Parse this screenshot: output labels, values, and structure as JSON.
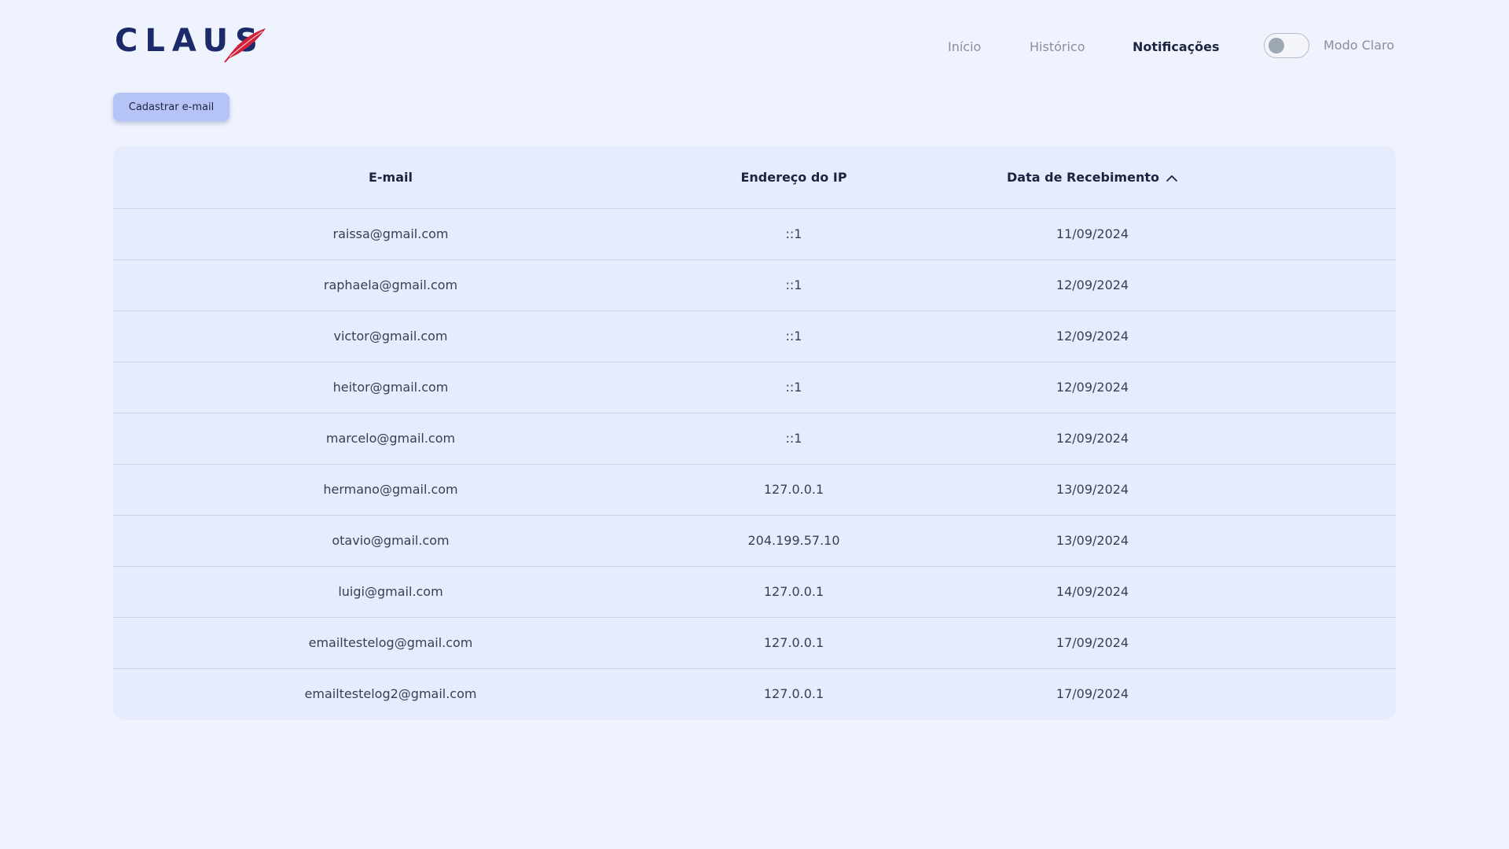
{
  "brand": {
    "logo_text": "CLAUS",
    "accent_color": "#d0213a",
    "primary_color": "#1a2a6a"
  },
  "nav": {
    "items": [
      {
        "label": "Início",
        "active": false
      },
      {
        "label": "Histórico",
        "active": false
      },
      {
        "label": "Notificações",
        "active": true
      }
    ]
  },
  "theme_toggle": {
    "label": "Modo Claro",
    "enabled": false
  },
  "actions": {
    "register_label": "Cadastrar e-mail"
  },
  "table": {
    "columns": [
      {
        "label": "E-mail"
      },
      {
        "label": "Endereço do IP"
      },
      {
        "label": "Data de Recebimento",
        "sort": "ascending",
        "sort_icon": "chevron-up-icon"
      }
    ],
    "rows": [
      {
        "email": "raissa@gmail.com",
        "ip": "::1",
        "date": "11/09/2024"
      },
      {
        "email": "raphaela@gmail.com",
        "ip": "::1",
        "date": "12/09/2024"
      },
      {
        "email": "victor@gmail.com",
        "ip": "::1",
        "date": "12/09/2024"
      },
      {
        "email": "heitor@gmail.com",
        "ip": "::1",
        "date": "12/09/2024"
      },
      {
        "email": "marcelo@gmail.com",
        "ip": "::1",
        "date": "12/09/2024"
      },
      {
        "email": "hermano@gmail.com",
        "ip": "127.0.0.1",
        "date": "13/09/2024"
      },
      {
        "email": "otavio@gmail.com",
        "ip": "204.199.57.10",
        "date": "13/09/2024"
      },
      {
        "email": "luigi@gmail.com",
        "ip": "127.0.0.1",
        "date": "14/09/2024"
      },
      {
        "email": "emailtestelog@gmail.com",
        "ip": "127.0.0.1",
        "date": "17/09/2024"
      },
      {
        "email": "emailtestelog2@gmail.com",
        "ip": "127.0.0.1",
        "date": "17/09/2024"
      }
    ]
  }
}
